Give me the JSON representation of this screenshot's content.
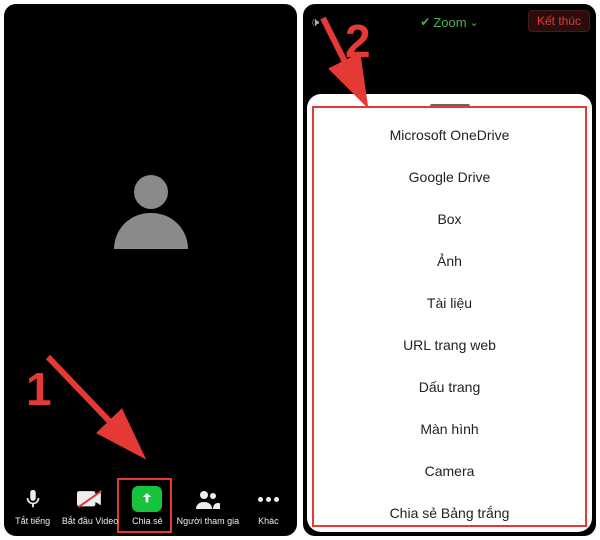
{
  "annotations": {
    "step1": "1",
    "step2": "2"
  },
  "left": {
    "toolbar": {
      "mute": "Tắt tiếng",
      "video": "Bắt đầu Video",
      "share": "Chia sẻ",
      "participants": "Người tham gia",
      "more": "Khác"
    }
  },
  "right": {
    "speaker_icon": "🔊",
    "zoom_label": "Zoom",
    "end_label": "Kết thúc",
    "share_options": [
      "Microsoft OneDrive",
      "Google Drive",
      "Box",
      "Ảnh",
      "Tài liệu",
      "URL trang web",
      "Dấu trang",
      "Màn hình",
      "Camera",
      "Chia sẻ Bảng trắng"
    ]
  }
}
